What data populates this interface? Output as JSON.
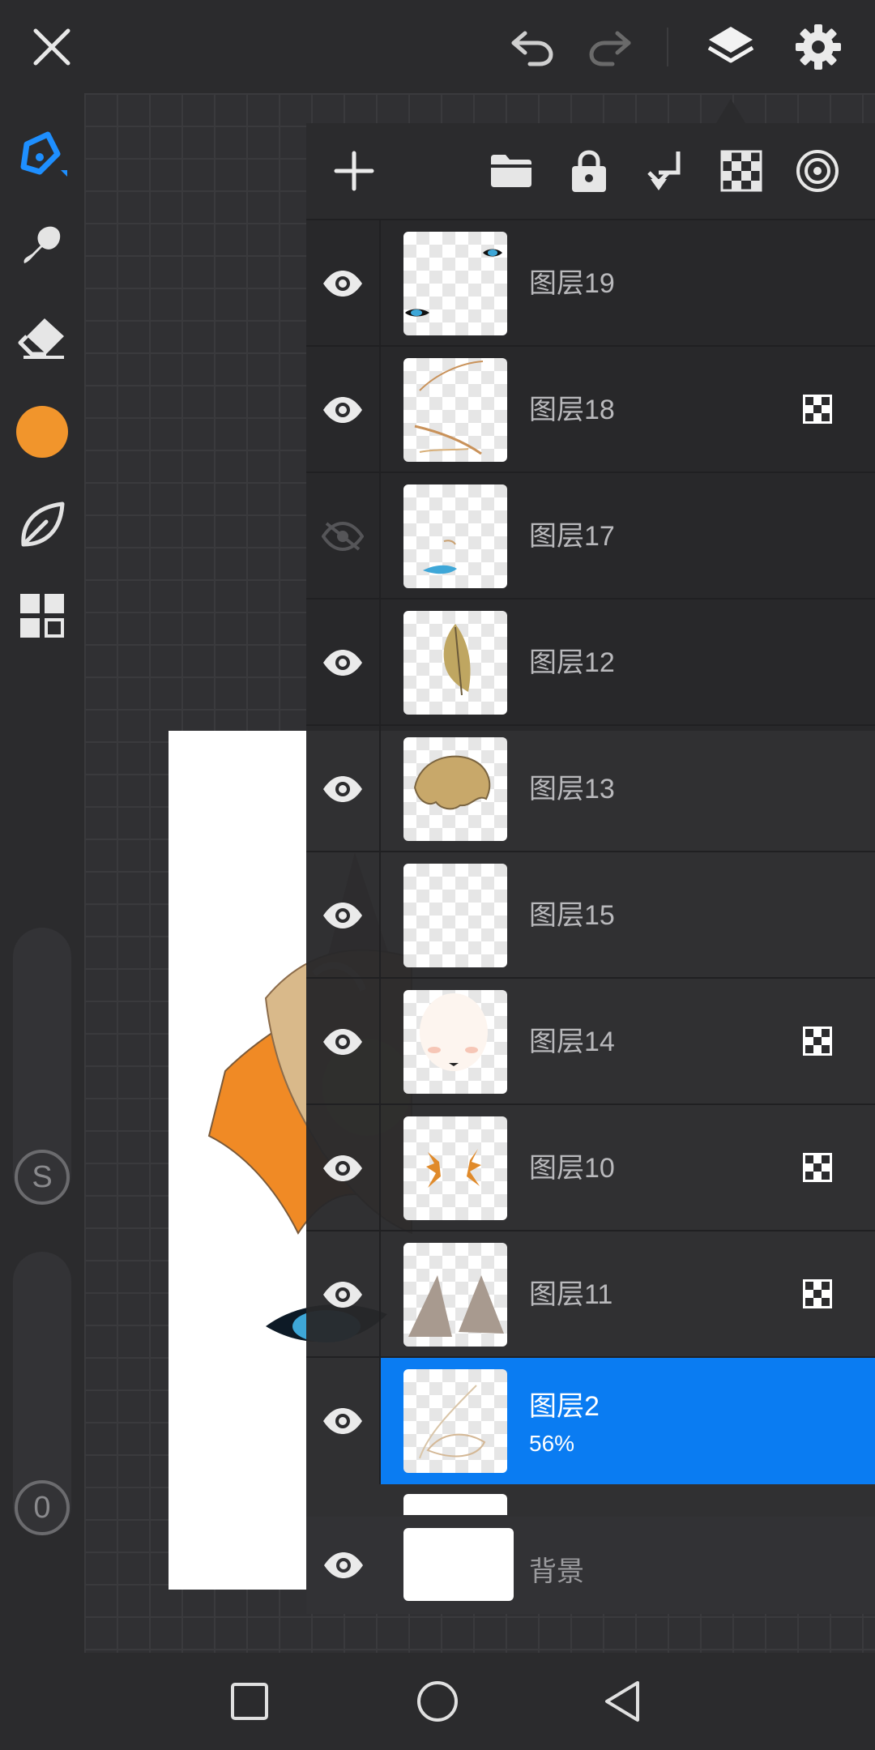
{
  "colors": {
    "accent": "#0a7cf2",
    "brush_color": "#f1952c"
  },
  "top_bar": {
    "icons": [
      "close-icon",
      "undo-icon",
      "redo-icon",
      "layers-icon",
      "settings-icon"
    ]
  },
  "left_toolbar": {
    "tools": [
      "pen-icon",
      "smudge-icon",
      "eraser-icon",
      "color-swatch",
      "leaf-icon",
      "grid-icon"
    ],
    "knob_top": "S",
    "knob_bottom": "0"
  },
  "layer_toolbar": {
    "icons": [
      "add-layer-icon",
      "folder-icon",
      "lock-icon",
      "merge-down-icon",
      "transparency-icon",
      "target-icon"
    ]
  },
  "layers": [
    {
      "name": "图层19",
      "visible": true,
      "clipped": false
    },
    {
      "name": "图层18",
      "visible": true,
      "clipped": true
    },
    {
      "name": "图层17",
      "visible": false,
      "clipped": false
    },
    {
      "name": "图层12",
      "visible": true,
      "clipped": false
    },
    {
      "name": "图层13",
      "visible": true,
      "clipped": false
    },
    {
      "name": "图层15",
      "visible": true,
      "clipped": false
    },
    {
      "name": "图层14",
      "visible": true,
      "clipped": true
    },
    {
      "name": "图层10",
      "visible": true,
      "clipped": true
    },
    {
      "name": "图层11",
      "visible": true,
      "clipped": true
    },
    {
      "name": "图层2",
      "visible": true,
      "clipped": false,
      "selected": true,
      "opacity": "56%"
    }
  ],
  "background_layer": {
    "name": "背景"
  },
  "nav": {
    "icons": [
      "recent-apps-icon",
      "home-icon",
      "back-icon"
    ]
  }
}
